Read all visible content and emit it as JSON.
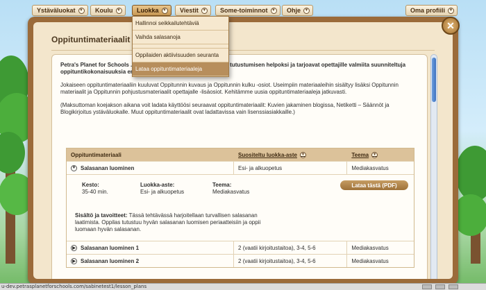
{
  "nav": {
    "items": [
      {
        "label": "Ystäväluokat"
      },
      {
        "label": "Koulu"
      },
      {
        "label": "Luokka"
      },
      {
        "label": "Viestit"
      },
      {
        "label": "Some-toiminnot"
      },
      {
        "label": "Ohje"
      },
      {
        "label": "Oma profiili"
      }
    ],
    "dropdown": [
      "Hallinnoi seikkailutehtäviä",
      "Vaihda salasanoja",
      "Oppilaiden aktiivisuuden seuranta",
      "Lataa oppituntimateriaaleja"
    ]
  },
  "panel": {
    "title": "Oppituntimateriaalit",
    "intro_lead": "Petra's Planet for Schools ... ohjelmiston käyttöönoton ja siihen tutustumisen helpoksi ja tarjoavat opettajille valmiita suunniteltuja oppituntikokonaisuuksia eri aihealueisiin.",
    "intro_p2": "Jokaiseen oppituntimateriaaliin kuuluvat Oppitunnin kuvaus ja Oppitunnin kulku -osiot. Useimpiin materiaaleihin sisältyy lisäksi Oppitunnin materiaalit ja Oppitunnin pohjustusmateriaalit opettajalle -lisäosiot. Kehitämme uusia oppituntimateriaaleja jatkuvasti.",
    "intro_p3": "(Maksuttoman koejakson aikana voit ladata käyttöösi seuraavat oppituntimateriaalit: Kuvien jakaminen blogissa, Netiketti – Säännöt ja Blogikirjoitus ystäväluokalle. Muut oppituntimateriaalit ovat ladattavissa vain lisenssiasiakkaille.)"
  },
  "table": {
    "headers": {
      "col1": "Oppituntimateriaali",
      "col2": "Suositeltu luokka-aste",
      "col3": "Teema"
    },
    "expanded": {
      "name": "Salasanan luominen",
      "grade": "Esi- ja alkuopetus",
      "theme": "Mediakasvatus",
      "duration_label": "Kesto:",
      "duration": "35-40 min.",
      "grade_label": "Luokka-aste:",
      "theme_label": "Teema:",
      "download": "Lataa tästä (PDF)",
      "goals_label": "Sisältö ja tavoitteet:",
      "goals": "Tässä tehtävässä harjoitellaan turvallisen salasanan laatimista. Oppilas tutustuu hyvän salasanan luomisen periaatteisiin ja oppii luomaan hyvän salasanan."
    },
    "rows": [
      {
        "name": "Salasanan luominen 1",
        "grade": "2 (vaatii kirjoitustaitoa), 3-4, 5-6",
        "theme": "Mediakasvatus"
      },
      {
        "name": "Salasanan luominen 2",
        "grade": "2 (vaatii kirjoitustaitoa), 3-4, 5-6",
        "theme": "Mediakasvatus"
      }
    ]
  },
  "status": {
    "url": "u-dev.petrasplanetforschools.com/sabinetest1/lesson_plans"
  },
  "colors": {
    "frame": "#9b6b3a",
    "panel": "#f3e6cc",
    "header": "#dcc29a",
    "accent": "#b78e5c"
  }
}
